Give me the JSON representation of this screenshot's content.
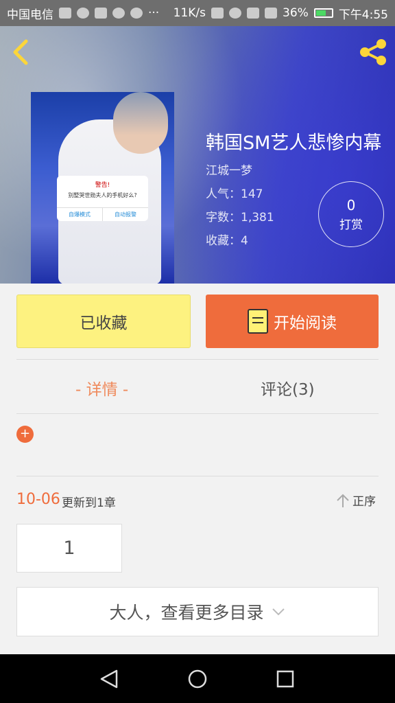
{
  "status_bar": {
    "carrier": "中国电信",
    "network_speed": "11K/s",
    "battery": "36%",
    "time": "下午4:55"
  },
  "book": {
    "title": "韩国SM艺人悲惨内幕",
    "author": "江城一梦",
    "popularity": "人气：147",
    "word_count": "字数：1,381",
    "favorites": "收藏：4",
    "cover_dialog": {
      "title": "警告!",
      "message": "别墅哭世勋夫人的手机好么?",
      "button_left": "自爆模式",
      "button_right": "自动报警"
    }
  },
  "tip": {
    "count": "0",
    "label": "打赏"
  },
  "actions": {
    "favorited_label": "已收藏",
    "start_reading_label": "开始阅读"
  },
  "tabs": {
    "detail": "- 详情 -",
    "comments": "评论(3)"
  },
  "expand_button": "+",
  "update": {
    "date": "10-06",
    "text": "更新到1章",
    "sort_label": "正序"
  },
  "chapters": [
    "1"
  ],
  "more_catalog_label": "大人，查看更多目录"
}
